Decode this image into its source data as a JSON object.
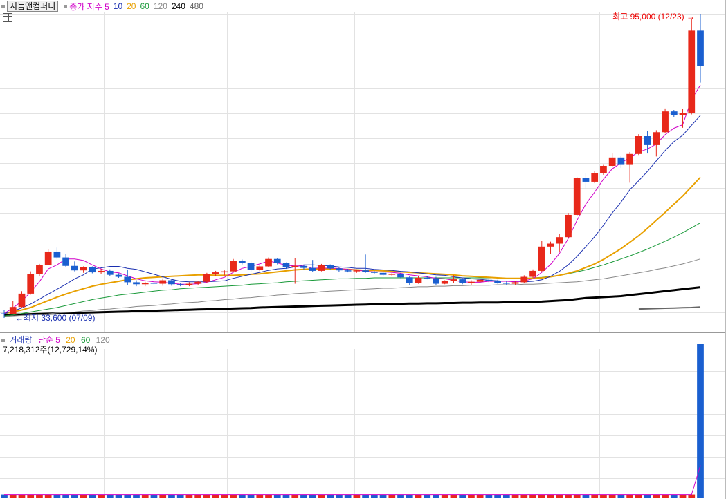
{
  "header": {
    "stock_name": "지놈앤컴퍼니",
    "ma_label": "종가 지수 5",
    "ma_periods": [
      "10",
      "20",
      "60",
      "120",
      "240",
      "480"
    ]
  },
  "annotations": {
    "high_label": "최고 95,000 (12/23)",
    "low_label": "최저 33,600 (07/09)"
  },
  "volume_header": {
    "title": "거래량",
    "ma_label": "단순 5",
    "ma_periods": [
      "20",
      "60",
      "120"
    ],
    "info": "7,218,312주(12,729,14%)"
  },
  "colors": {
    "up": "#e8281a",
    "down": "#1a5fd0",
    "ma5": "#d000c8",
    "ma10": "#1a2fb0",
    "ma20": "#e8a000",
    "ma60": "#1a9a3a",
    "ma120": "#888888",
    "ma240": "#000000",
    "ma480": "#666666"
  },
  "chart_data": {
    "type": "candlestick",
    "price_range": [
      33600,
      95000
    ],
    "high": {
      "value": 95000,
      "date": "12/23"
    },
    "low": {
      "value": 33600,
      "date": "07/09"
    },
    "candles": [
      [
        34500,
        35200,
        33600,
        34400
      ],
      [
        34400,
        37000,
        34300,
        35800
      ],
      [
        35800,
        39000,
        35700,
        38500
      ],
      [
        38500,
        43000,
        38300,
        42500
      ],
      [
        42500,
        44500,
        42000,
        44300
      ],
      [
        44300,
        47500,
        44200,
        47000
      ],
      [
        47000,
        47800,
        45500,
        45800
      ],
      [
        45800,
        46500,
        43900,
        44100
      ],
      [
        44100,
        45000,
        43000,
        43200
      ],
      [
        43200,
        44000,
        42700,
        43900
      ],
      [
        43900,
        44000,
        42600,
        42800
      ],
      [
        42800,
        43500,
        42500,
        43100
      ],
      [
        43100,
        43400,
        42100,
        42300
      ],
      [
        42300,
        42600,
        41700,
        41900
      ],
      [
        41900,
        43300,
        40200,
        40800
      ],
      [
        40800,
        41200,
        40000,
        40400
      ],
      [
        40400,
        40900,
        40000,
        40700
      ],
      [
        40700,
        41100,
        40300,
        40500
      ],
      [
        40500,
        41600,
        40100,
        41200
      ],
      [
        41200,
        41400,
        40100,
        40400
      ],
      [
        40400,
        40600,
        40000,
        40200
      ],
      [
        40200,
        40800,
        40000,
        40500
      ],
      [
        40500,
        41000,
        40300,
        40900
      ],
      [
        40900,
        42700,
        40700,
        42400
      ],
      [
        42400,
        43100,
        42000,
        42800
      ],
      [
        42800,
        43200,
        42200,
        43000
      ],
      [
        43000,
        45500,
        42800,
        45100
      ],
      [
        45100,
        45400,
        44400,
        44700
      ],
      [
        44700,
        45200,
        42900,
        43300
      ],
      [
        43300,
        44300,
        43000,
        44000
      ],
      [
        44000,
        45800,
        43800,
        45500
      ],
      [
        45500,
        45600,
        44400,
        44700
      ],
      [
        44700,
        44800,
        43500,
        43900
      ],
      [
        43900,
        45700,
        40500,
        44100
      ],
      [
        44100,
        44300,
        43400,
        43700
      ],
      [
        43700,
        45300,
        42900,
        43100
      ],
      [
        43100,
        44500,
        43000,
        44200
      ],
      [
        44200,
        44400,
        43400,
        43600
      ],
      [
        43600,
        43800,
        42900,
        43200
      ],
      [
        43200,
        43500,
        42800,
        43000
      ],
      [
        43000,
        43400,
        42700,
        43200
      ],
      [
        43200,
        46400,
        42700,
        42900
      ],
      [
        42900,
        43100,
        42500,
        42700
      ],
      [
        42700,
        42900,
        42100,
        42300
      ],
      [
        42300,
        42700,
        42000,
        42500
      ],
      [
        42500,
        42700,
        41600,
        41800
      ],
      [
        41800,
        42100,
        40300,
        40700
      ],
      [
        40700,
        42000,
        40500,
        41700
      ],
      [
        41700,
        42000,
        41400,
        41600
      ],
      [
        41600,
        41900,
        40300,
        40500
      ],
      [
        40500,
        41200,
        40400,
        41000
      ],
      [
        41000,
        42200,
        40700,
        41400
      ],
      [
        41400,
        41600,
        40400,
        40700
      ],
      [
        40700,
        41200,
        40300,
        40900
      ],
      [
        40900,
        41500,
        40700,
        41300
      ],
      [
        41300,
        41500,
        40800,
        41100
      ],
      [
        41100,
        41300,
        40500,
        40700
      ],
      [
        40700,
        41000,
        40300,
        40500
      ],
      [
        40500,
        41000,
        40300,
        40800
      ],
      [
        40800,
        42200,
        40600,
        41900
      ],
      [
        41900,
        43400,
        41700,
        43100
      ],
      [
        43100,
        49200,
        42900,
        48000
      ],
      [
        48000,
        49000,
        46500,
        48600
      ],
      [
        48600,
        50500,
        47000,
        49900
      ],
      [
        49900,
        54800,
        49700,
        54400
      ],
      [
        54400,
        62000,
        54200,
        61800
      ],
      [
        61800,
        62800,
        59800,
        61100
      ],
      [
        61100,
        63200,
        60800,
        62800
      ],
      [
        62800,
        64500,
        62500,
        64300
      ],
      [
        64300,
        66800,
        64000,
        66000
      ],
      [
        66000,
        66300,
        63900,
        64500
      ],
      [
        64500,
        67100,
        60900,
        66700
      ],
      [
        66700,
        70700,
        66500,
        70300
      ],
      [
        70300,
        71300,
        66800,
        68500
      ],
      [
        68500,
        71500,
        66200,
        71100
      ],
      [
        71100,
        75900,
        70900,
        75300
      ],
      [
        75300,
        75600,
        74100,
        74500
      ],
      [
        74500,
        75800,
        72000,
        75000
      ],
      [
        75000,
        94000,
        74700,
        91600
      ],
      [
        91600,
        95000,
        81100,
        84400
      ]
    ],
    "ma5": [
      34500,
      35600,
      37000,
      38800,
      40900,
      43500,
      44300,
      45500,
      45500,
      45200,
      44300,
      43500,
      42900,
      42700,
      42100,
      41500,
      41100,
      40900,
      40800,
      40600,
      40400,
      40400,
      40500,
      40800,
      41300,
      41800,
      42800,
      43600,
      44000,
      44500,
      45100,
      44700,
      44200,
      44100,
      44100,
      43600,
      43700,
      43600,
      43600,
      43400,
      43300,
      43000,
      42900,
      42900,
      42800,
      42600,
      42300,
      42100,
      41900,
      41600,
      41500,
      41200,
      40900,
      40800,
      40800,
      41000,
      41000,
      41000,
      40900,
      41100,
      41500,
      42800,
      44400,
      46600,
      49600,
      53300,
      56600,
      59000,
      61600,
      63700,
      64900,
      66000,
      67100,
      67700,
      68700,
      70600,
      71900,
      72600,
      77800,
      80600
    ],
    "ma10": [
      34500,
      35000,
      35600,
      36400,
      37400,
      38400,
      39400,
      40400,
      41500,
      42300,
      43500,
      43700,
      44000,
      44000,
      43600,
      43400,
      42900,
      42400,
      41900,
      41400,
      41000,
      40900,
      40900,
      40900,
      41000,
      41100,
      41600,
      42000,
      42400,
      42800,
      43200,
      43500,
      43600,
      43900,
      44300,
      44300,
      44200,
      44100,
      43900,
      43800,
      43600,
      43600,
      43400,
      43300,
      43200,
      43000,
      42900,
      42700,
      42500,
      42300,
      42200,
      41900,
      41700,
      41500,
      41400,
      41200,
      41100,
      41000,
      41000,
      40900,
      41000,
      41300,
      42000,
      43000,
      44300,
      46000,
      48000,
      50000,
      52300,
      54800,
      57000,
      59500,
      61300,
      63200,
      65300,
      67400,
      69200,
      70500,
      72500,
      74500
    ],
    "ma20": [
      34500,
      34800,
      35200,
      35700,
      36400,
      37100,
      37800,
      38400,
      39000,
      39500,
      40000,
      40400,
      40700,
      41000,
      41300,
      41500,
      41700,
      41800,
      41900,
      42000,
      42100,
      42200,
      42300,
      42300,
      42200,
      42200,
      42200,
      42300,
      42400,
      42500,
      42700,
      42900,
      43100,
      43300,
      43400,
      43500,
      43500,
      43500,
      43400,
      43400,
      43300,
      43200,
      43200,
      43100,
      43000,
      42900,
      42800,
      42700,
      42600,
      42500,
      42400,
      42300,
      42100,
      42000,
      41900,
      41800,
      41700,
      41600,
      41600,
      41600,
      41600,
      41700,
      41900,
      42200,
      42600,
      43100,
      43800,
      44500,
      45400,
      46500,
      47600,
      48900,
      50200,
      51700,
      53300,
      54900,
      56600,
      58200,
      60100,
      62000
    ],
    "ma60": [
      34000,
      34200,
      34500,
      34800,
      35100,
      35400,
      35700,
      36100,
      36500,
      36900,
      37300,
      37600,
      37900,
      38200,
      38400,
      38600,
      38800,
      39000,
      39200,
      39300,
      39500,
      39600,
      39700,
      39800,
      39900,
      40000,
      40100,
      40200,
      40400,
      40500,
      40600,
      40700,
      40900,
      41000,
      41100,
      41200,
      41300,
      41400,
      41500,
      41500,
      41600,
      41600,
      41700,
      41700,
      41700,
      41700,
      41700,
      41700,
      41700,
      41700,
      41700,
      41700,
      41700,
      41700,
      41700,
      41700,
      41700,
      41600,
      41600,
      41600,
      41700,
      41800,
      42000,
      42200,
      42500,
      42900,
      43300,
      43800,
      44300,
      44900,
      45500,
      46100,
      46800,
      47500,
      48300,
      49100,
      49900,
      50800,
      51800,
      52800
    ],
    "ma120": [
      33900,
      34000,
      34100,
      34200,
      34300,
      34400,
      34600,
      34700,
      34800,
      35000,
      35100,
      35300,
      35400,
      35600,
      35700,
      35900,
      36000,
      36100,
      36300,
      36400,
      36600,
      36700,
      36800,
      37000,
      37100,
      37300,
      37400,
      37600,
      37700,
      37900,
      38000,
      38200,
      38300,
      38500,
      38600,
      38700,
      38900,
      39000,
      39100,
      39200,
      39300,
      39400,
      39500,
      39600,
      39600,
      39700,
      39800,
      39900,
      39900,
      40000,
      40000,
      40100,
      40100,
      40200,
      40200,
      40200,
      40300,
      40300,
      40300,
      40400,
      40400,
      40500,
      40600,
      40700,
      40800,
      40900,
      41100,
      41300,
      41500,
      41800,
      42100,
      42400,
      42700,
      43000,
      43400,
      43700,
      44100,
      44500,
      45000,
      45500
    ],
    "ma240": [
      34200,
      34250,
      34300,
      34350,
      34400,
      34450,
      34500,
      34550,
      34600,
      34650,
      34700,
      34750,
      34800,
      34850,
      34900,
      34950,
      35000,
      35050,
      35100,
      35150,
      35200,
      35250,
      35300,
      35350,
      35400,
      35450,
      35500,
      35550,
      35600,
      35700,
      35750,
      35800,
      35850,
      35900,
      35950,
      36000,
      36050,
      36100,
      36150,
      36200,
      36250,
      36300,
      36350,
      36400,
      36400,
      36450,
      36500,
      36500,
      36550,
      36550,
      36600,
      36600,
      36650,
      36650,
      36700,
      36700,
      36700,
      36750,
      36750,
      36800,
      36850,
      36900,
      37000,
      37100,
      37200,
      37400,
      37600,
      37700,
      37800,
      37900,
      38000,
      38200,
      38400,
      38600,
      38800,
      39000,
      39200,
      39400,
      39600,
      39800
    ],
    "ma480": [
      null,
      null,
      null,
      null,
      null,
      null,
      null,
      null,
      null,
      null,
      null,
      null,
      null,
      null,
      null,
      null,
      null,
      null,
      null,
      null,
      null,
      null,
      null,
      null,
      null,
      null,
      null,
      null,
      null,
      null,
      null,
      null,
      null,
      null,
      null,
      null,
      null,
      null,
      null,
      null,
      null,
      null,
      null,
      null,
      null,
      null,
      null,
      null,
      null,
      null,
      null,
      null,
      null,
      null,
      null,
      null,
      null,
      null,
      null,
      null,
      null,
      null,
      null,
      null,
      null,
      null,
      null,
      null,
      null,
      null,
      null,
      null,
      35400,
      35450,
      35500,
      35550,
      35600,
      35650,
      35700,
      35800
    ],
    "volume": [
      2,
      2,
      2,
      2,
      2,
      2,
      2,
      2,
      2,
      2,
      2,
      2,
      2,
      2,
      2,
      2,
      2,
      2,
      2,
      2,
      2,
      2,
      2,
      2,
      2,
      2,
      2,
      2,
      2,
      2,
      2,
      2,
      2,
      2,
      2,
      2,
      2,
      2,
      2,
      2,
      2,
      2,
      2,
      2,
      2,
      2,
      2,
      2,
      2,
      2,
      2,
      2,
      2,
      2,
      2,
      2,
      2,
      2,
      2,
      2,
      2,
      2,
      2,
      2,
      2,
      2,
      2,
      2,
      2,
      2,
      2,
      2,
      2,
      2,
      2,
      2,
      2,
      2,
      2,
      100
    ],
    "volume_ma5": [
      2,
      2,
      2,
      2,
      2,
      2,
      2,
      2,
      2,
      2,
      2,
      2,
      2,
      2,
      2,
      2,
      2,
      2,
      2,
      2,
      2,
      2,
      2,
      2,
      2,
      2,
      2,
      2,
      2,
      2,
      2,
      2,
      2,
      2,
      2,
      2,
      2,
      2,
      2,
      2,
      2,
      2,
      2,
      2,
      2,
      2,
      2,
      2,
      2,
      2,
      2,
      2,
      2,
      2,
      2,
      2,
      2,
      2,
      2,
      2,
      2,
      2,
      2,
      2,
      2,
      2,
      2,
      2,
      2,
      2,
      2,
      2,
      2,
      2,
      2,
      2,
      2,
      2,
      2,
      21
    ]
  }
}
